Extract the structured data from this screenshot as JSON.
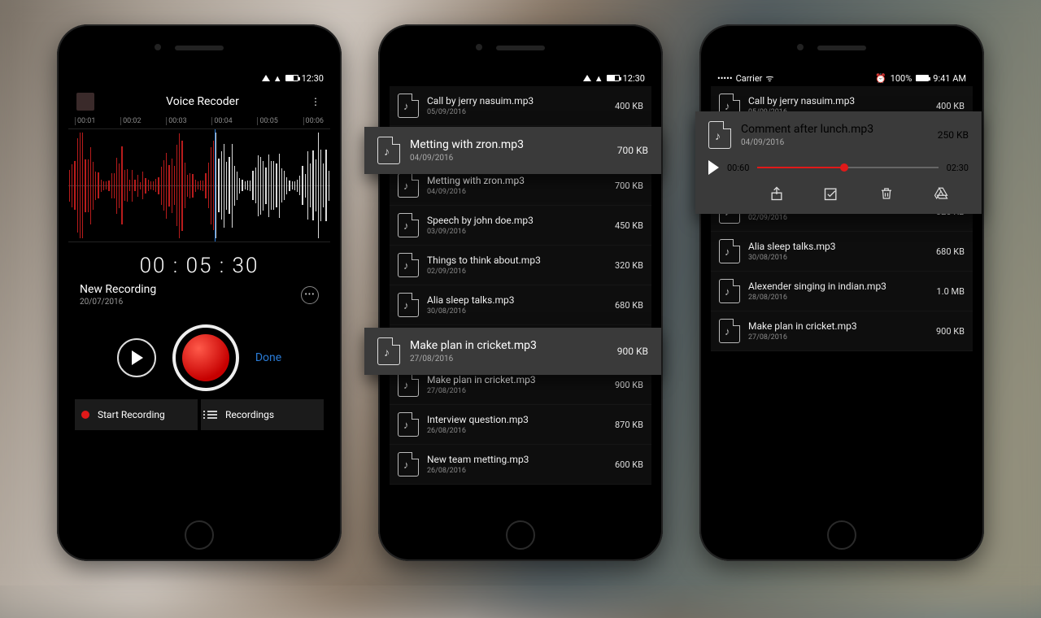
{
  "status": {
    "time_android": "12:30",
    "time_ios": "9:41 AM",
    "carrier": "Carrier",
    "alarm_pct": "100%"
  },
  "recorder": {
    "title": "Voice Recoder",
    "ticks": [
      "00:01",
      "00:02",
      "00:03",
      "00:04",
      "00:05",
      "00:06"
    ],
    "timer": "00 : 05 : 30",
    "name": "New Recording",
    "date": "20/07/2016",
    "done": "Done",
    "start_label": "Start Recording",
    "recordings_label": "Recordings"
  },
  "files": [
    {
      "name": "Call by jerry nasuim.mp3",
      "date": "05/09/2016",
      "size": "400 KB"
    },
    {
      "name": "Comment after lunch.mp3",
      "date": "04/09/2016",
      "size": "250 KB"
    },
    {
      "name": "Metting with zron.mp3",
      "date": "04/09/2016",
      "size": "700 KB"
    },
    {
      "name": "Speech by john doe.mp3",
      "date": "03/09/2016",
      "size": "450 KB"
    },
    {
      "name": "Things to think about.mp3",
      "date": "02/09/2016",
      "size": "320 KB"
    },
    {
      "name": "Alia sleep talks.mp3",
      "date": "30/08/2016",
      "size": "680 KB"
    },
    {
      "name": "Alexender singing in indian.mp3",
      "date": "28/08/2016",
      "size": "1.0 MB"
    },
    {
      "name": "Make plan in cricket.mp3",
      "date": "27/08/2016",
      "size": "900 KB"
    },
    {
      "name": "Interview question.mp3",
      "date": "26/08/2016",
      "size": "870 KB"
    },
    {
      "name": "New team metting.mp3",
      "date": "26/08/2016",
      "size": "600 KB"
    }
  ],
  "player": {
    "file": {
      "name": "Comment after lunch.mp3",
      "date": "04/09/2016",
      "size": "250 KB"
    },
    "pos": "00:60",
    "dur": "02:30"
  },
  "p3_stub_date": "04/09/2016"
}
